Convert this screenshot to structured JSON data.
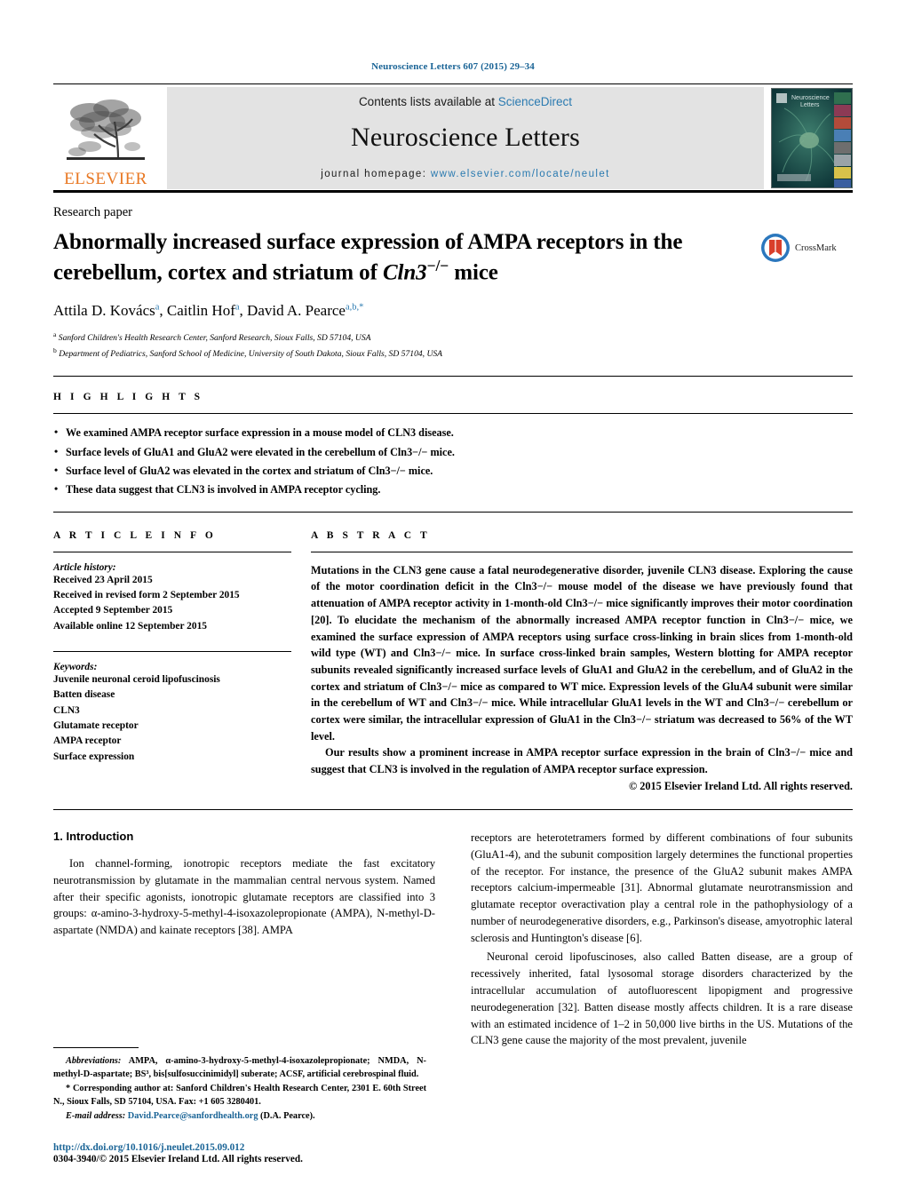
{
  "running_head": "Neuroscience Letters 607 (2015) 29–34",
  "masthead": {
    "publisher_name": "ELSEVIER",
    "contents_prefix": "Contents lists available at ",
    "contents_link": "ScienceDirect",
    "journal_title": "Neuroscience Letters",
    "homepage_prefix": "journal homepage: ",
    "homepage_url": "www.elsevier.com/locate/neulet",
    "cover_title": "Neuroscience Letters"
  },
  "article": {
    "paper_type": "Research paper",
    "title_line1": "Abnormally increased surface expression of AMPA receptors in the",
    "title_line2_pre": "cerebellum, cortex and striatum of ",
    "title_gene": "Cln3",
    "title_sup": "−/−",
    "title_line2_post": " mice",
    "crossmark_label": "CrossMark",
    "authors": [
      {
        "name": "Attila D. Kovács",
        "sup": "a"
      },
      {
        "name": "Caitlin Hof",
        "sup": "a"
      },
      {
        "name": "David A. Pearce",
        "sup": "a,b,*"
      }
    ],
    "affiliations": [
      {
        "marker": "a",
        "text": "Sanford Children's Health Research Center, Sanford Research, Sioux Falls, SD 57104, USA"
      },
      {
        "marker": "b",
        "text": "Department of Pediatrics, Sanford School of Medicine, University of South Dakota, Sioux Falls, SD 57104, USA"
      }
    ]
  },
  "highlights": {
    "label": "H I G H L I G H T S",
    "items": [
      "We examined AMPA receptor surface expression in a mouse model of CLN3 disease.",
      "Surface levels of GluA1 and GluA2 were elevated in the cerebellum of Cln3−/− mice.",
      "Surface level of GluA2 was elevated in the cortex and striatum of Cln3−/− mice.",
      "These data suggest that CLN3 is involved in AMPA receptor cycling."
    ]
  },
  "article_info": {
    "label": "A R T I C L E   I N F O",
    "history_label": "Article history:",
    "history": [
      "Received 23 April 2015",
      "Received in revised form 2 September 2015",
      "Accepted 9 September 2015",
      "Available online 12 September 2015"
    ],
    "keywords_label": "Keywords:",
    "keywords": [
      "Juvenile neuronal ceroid lipofuscinosis",
      "Batten disease",
      "CLN3",
      "Glutamate receptor",
      "AMPA receptor",
      "Surface expression"
    ]
  },
  "abstract": {
    "label": "A B S T R A C T",
    "paragraph1": "Mutations in the CLN3 gene cause a fatal neurodegenerative disorder, juvenile CLN3 disease. Exploring the cause of the motor coordination deficit in the Cln3−/− mouse model of the disease we have previously found that attenuation of AMPA receptor activity in 1-month-old Cln3−/− mice significantly improves their motor coordination [20]. To elucidate the mechanism of the abnormally increased AMPA receptor function in Cln3−/− mice, we examined the surface expression of AMPA receptors using surface cross-linking in brain slices from 1-month-old wild type (WT) and Cln3−/− mice. In surface cross-linked brain samples, Western blotting for AMPA receptor subunits revealed significantly increased surface levels of GluA1 and GluA2 in the cerebellum, and of GluA2 in the cortex and striatum of Cln3−/− mice as compared to WT mice. Expression levels of the GluA4 subunit were similar in the cerebellum of WT and Cln3−/− mice. While intracellular GluA1 levels in the WT and Cln3−/− cerebellum or cortex were similar, the intracellular expression of GluA1 in the Cln3−/− striatum was decreased to 56% of the WT level.",
    "paragraph2": "Our results show a prominent increase in AMPA receptor surface expression in the brain of Cln3−/− mice and suggest that CLN3 is involved in the regulation of AMPA receptor surface expression.",
    "copyright": "© 2015 Elsevier Ireland Ltd. All rights reserved."
  },
  "body": {
    "section_number_title": "1.  Introduction",
    "left_paragraph": "Ion channel-forming, ionotropic receptors mediate the fast excitatory neurotransmission by glutamate in the mammalian central nervous system. Named after their specific agonists, ionotropic glutamate receptors are classified into 3 groups: α-amino-3-hydroxy-5-methyl-4-isoxazolepropionate (AMPA), N-methyl-D-aspartate (NMDA) and kainate receptors [38]. AMPA",
    "right_paragraph1": "receptors are heterotetramers formed by different combinations of four subunits (GluA1-4), and the subunit composition largely determines the functional properties of the receptor. For instance, the presence of the GluA2 subunit makes AMPA receptors calcium-impermeable [31]. Abnormal glutamate neurotransmission and glutamate receptor overactivation play a central role in the pathophysiology of a number of neurodegenerative disorders, e.g., Parkinson's disease, amyotrophic lateral sclerosis and Huntington's disease [6].",
    "right_paragraph2": "Neuronal ceroid lipofuscinoses, also called Batten disease, are a group of recessively inherited, fatal lysosomal storage disorders characterized by the intracellular accumulation of autofluorescent lipopigment and progressive neurodegeneration [32]. Batten disease mostly affects children. It is a rare disease with an estimated incidence of 1–2 in 50,000 live births in the US. Mutations of the CLN3 gene cause the majority of the most prevalent, juvenile"
  },
  "footnotes": {
    "abbreviations_label": "Abbreviations:",
    "abbreviations_text": "AMPA, α-amino-3-hydroxy-5-methyl-4-isoxazolepropionate; NMDA, N-methyl-D-aspartate; BS³, bis[sulfosuccinimidyl] suberate; ACSF, artificial cerebrospinal fluid.",
    "corresponding_marker": "*",
    "corresponding_text": "Corresponding author at: Sanford Children's Health Research Center, 2301 E. 60th Street N., Sioux Falls, SD 57104, USA. Fax: +1 605 3280401.",
    "email_label": "E-mail address:",
    "email": "David.Pearce@sanfordhealth.org",
    "email_suffix": "(D.A. Pearce).",
    "doi_url": "http://dx.doi.org/10.1016/j.neulet.2015.09.012",
    "issn_line": "0304-3940/© 2015 Elsevier Ireland Ltd. All rights reserved."
  },
  "colors": {
    "link_blue": "#2a7ab0",
    "ref_blue": "#1a6496",
    "elsevier_orange": "#E87722",
    "band_gray": "#e3e3e3"
  }
}
